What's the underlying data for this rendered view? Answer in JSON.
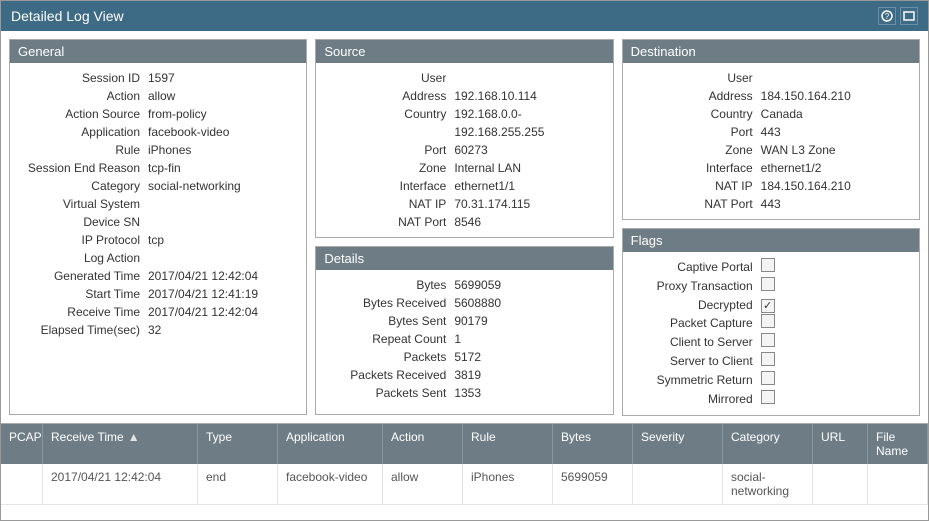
{
  "title": "Detailed Log View",
  "general": {
    "header": "General",
    "rows": [
      {
        "label": "Session ID",
        "value": "1597"
      },
      {
        "label": "Action",
        "value": "allow"
      },
      {
        "label": "Action Source",
        "value": "from-policy"
      },
      {
        "label": "Application",
        "value": "facebook-video"
      },
      {
        "label": "Rule",
        "value": "iPhones"
      },
      {
        "label": "Session End Reason",
        "value": "tcp-fin"
      },
      {
        "label": "Category",
        "value": "social-networking"
      },
      {
        "label": "Virtual System",
        "value": ""
      },
      {
        "label": "Device SN",
        "value": ""
      },
      {
        "label": "IP Protocol",
        "value": "tcp"
      },
      {
        "label": "Log Action",
        "value": ""
      },
      {
        "label": "Generated Time",
        "value": "2017/04/21 12:42:04"
      },
      {
        "label": "Start Time",
        "value": "2017/04/21 12:41:19"
      },
      {
        "label": "Receive Time",
        "value": "2017/04/21 12:42:04"
      },
      {
        "label": "Elapsed Time(sec)",
        "value": "32"
      }
    ]
  },
  "source": {
    "header": "Source",
    "rows": [
      {
        "label": "User",
        "value": ""
      },
      {
        "label": "Address",
        "value": "192.168.10.114"
      },
      {
        "label": "Country",
        "value": "192.168.0.0-192.168.255.255"
      },
      {
        "label": "Port",
        "value": "60273"
      },
      {
        "label": "Zone",
        "value": "Internal LAN"
      },
      {
        "label": "Interface",
        "value": "ethernet1/1"
      },
      {
        "label": "NAT IP",
        "value": "70.31.174.115"
      },
      {
        "label": "NAT Port",
        "value": "8546"
      }
    ]
  },
  "destination": {
    "header": "Destination",
    "rows": [
      {
        "label": "User",
        "value": ""
      },
      {
        "label": "Address",
        "value": "184.150.164.210"
      },
      {
        "label": "Country",
        "value": "Canada"
      },
      {
        "label": "Port",
        "value": "443"
      },
      {
        "label": "Zone",
        "value": "WAN L3 Zone"
      },
      {
        "label": "Interface",
        "value": "ethernet1/2"
      },
      {
        "label": "NAT IP",
        "value": "184.150.164.210"
      },
      {
        "label": "NAT Port",
        "value": "443"
      }
    ]
  },
  "details": {
    "header": "Details",
    "rows": [
      {
        "label": "Bytes",
        "value": "5699059"
      },
      {
        "label": "Bytes Received",
        "value": "5608880"
      },
      {
        "label": "Bytes Sent",
        "value": "90179"
      },
      {
        "label": "Repeat Count",
        "value": "1"
      },
      {
        "label": "Packets",
        "value": "5172"
      },
      {
        "label": "Packets Received",
        "value": "3819"
      },
      {
        "label": "Packets Sent",
        "value": "1353"
      }
    ]
  },
  "flags": {
    "header": "Flags",
    "items": [
      {
        "label": "Captive Portal",
        "checked": false
      },
      {
        "label": "Proxy Transaction",
        "checked": false
      },
      {
        "label": "Decrypted",
        "checked": true
      },
      {
        "label": "Packet Capture",
        "checked": false
      },
      {
        "label": "Client to Server",
        "checked": false
      },
      {
        "label": "Server to Client",
        "checked": false
      },
      {
        "label": "Symmetric Return",
        "checked": false
      },
      {
        "label": "Mirrored",
        "checked": false
      }
    ]
  },
  "grid": {
    "columns": [
      "PCAP",
      "Receive Time",
      "Type",
      "Application",
      "Action",
      "Rule",
      "Bytes",
      "Severity",
      "Category",
      "URL",
      "File Name"
    ],
    "row": {
      "pcap": "",
      "receive_time": "2017/04/21 12:42:04",
      "type": "end",
      "application": "facebook-video",
      "action": "allow",
      "rule": "iPhones",
      "bytes": "5699059",
      "severity": "",
      "category": "social-networking",
      "url": "",
      "filename": ""
    }
  }
}
